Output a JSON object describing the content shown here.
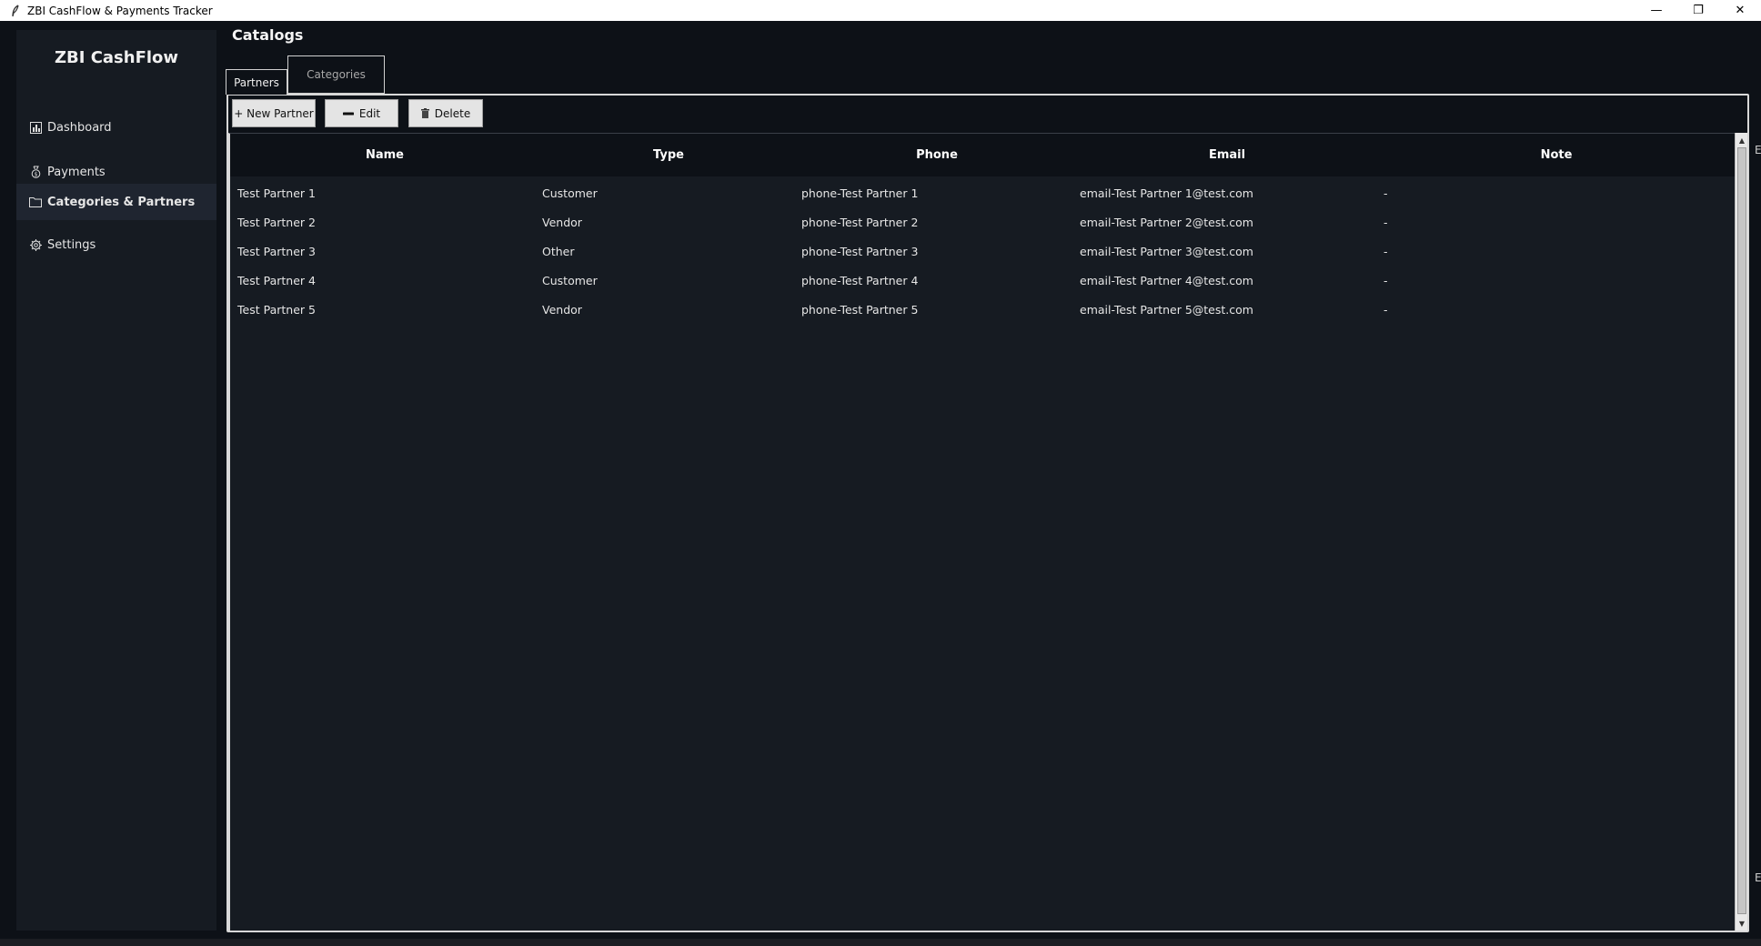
{
  "window": {
    "title": "ZBI CashFlow & Payments Tracker",
    "minimize_glyph": "—",
    "maximize_glyph": "❐",
    "close_glyph": "✕"
  },
  "sidebar": {
    "brand": "ZBI CashFlow",
    "items": [
      {
        "label": "Dashboard",
        "icon": "bar-chart-icon",
        "active": false
      },
      {
        "label": "Payments",
        "icon": "money-bag-icon",
        "active": false
      },
      {
        "label": "Categories & Partners",
        "icon": "folder-icon",
        "active": true
      },
      {
        "label": "Settings",
        "icon": "gear-icon",
        "active": false
      }
    ]
  },
  "main": {
    "title": "Catalogs",
    "tabs": [
      {
        "label": "Partners",
        "selected": true
      },
      {
        "label": "Categories",
        "selected": false
      }
    ],
    "toolbar": {
      "new_label": "+ New Partner",
      "edit_label": "Edit",
      "delete_label": "Delete",
      "edit_icon": "pencil-icon",
      "delete_icon": "trash-icon"
    },
    "table": {
      "columns": [
        "Name",
        "Type",
        "Phone",
        "Email",
        "Note"
      ],
      "rows": [
        [
          "Test Partner 1",
          "Customer",
          "phone-Test Partner 1",
          "email-Test Partner 1@test.com",
          "-"
        ],
        [
          "Test Partner 2",
          "Vendor",
          "phone-Test Partner 2",
          "email-Test Partner 2@test.com",
          "-"
        ],
        [
          "Test Partner 3",
          "Other",
          "phone-Test Partner 3",
          "email-Test Partner 3@test.com",
          "-"
        ],
        [
          "Test Partner 4",
          "Customer",
          "phone-Test Partner 4",
          "email-Test Partner 4@test.com",
          "-"
        ],
        [
          "Test Partner 5",
          "Vendor",
          "phone-Test Partner 5",
          "email-Test Partner 5@test.com",
          "-"
        ]
      ]
    },
    "edge_glyph": "E"
  },
  "colors": {
    "background": "#0d1117",
    "sidebar": "#161b22",
    "table_body": "#161b22",
    "button": "#e4e4e4"
  }
}
